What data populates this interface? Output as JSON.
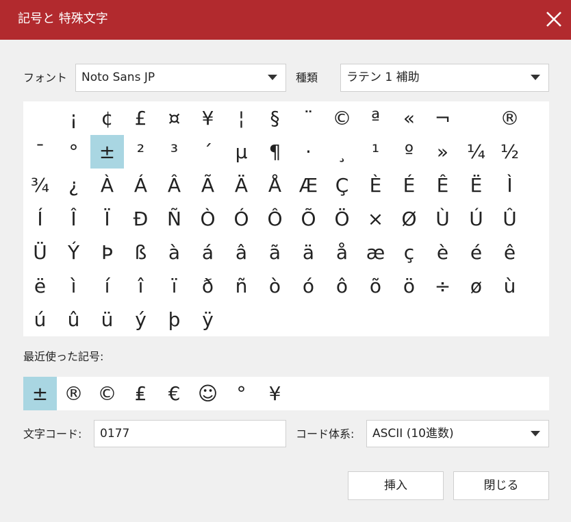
{
  "title": "記号と 特殊文字",
  "font": {
    "label": "フォント",
    "value": "Noto Sans JP"
  },
  "category": {
    "label": "種類",
    "value": "ラテン 1 補助"
  },
  "symbols": [
    "",
    "¡",
    "¢",
    "£",
    "¤",
    "¥",
    "¦",
    "§",
    "¨",
    "©",
    "ª",
    "«",
    "¬",
    "",
    "®",
    "¯",
    "°",
    "±",
    "²",
    "³",
    "´",
    "µ",
    "¶",
    "·",
    "¸",
    "¹",
    "º",
    "»",
    "¼",
    "½",
    "¾",
    "¿",
    "À",
    "Á",
    "Â",
    "Ã",
    "Ä",
    "Å",
    "Æ",
    "Ç",
    "È",
    "É",
    "Ê",
    "Ë",
    "Ì",
    "Í",
    "Î",
    "Ï",
    "Ð",
    "Ñ",
    "Ò",
    "Ó",
    "Ô",
    "Õ",
    "Ö",
    "×",
    "Ø",
    "Ù",
    "Ú",
    "Û",
    "Ü",
    "Ý",
    "Þ",
    "ß",
    "à",
    "á",
    "â",
    "ã",
    "ä",
    "å",
    "æ",
    "ç",
    "è",
    "é",
    "ê",
    "ë",
    "ì",
    "í",
    "î",
    "ï",
    "ð",
    "ñ",
    "ò",
    "ó",
    "ô",
    "õ",
    "ö",
    "÷",
    "ø",
    "ù",
    "ú",
    "û",
    "ü",
    "ý",
    "þ",
    "ÿ"
  ],
  "selected_symbol": "±",
  "recent_label": "最近使った記号:",
  "recent_symbols": [
    "±",
    "®",
    "©",
    "₤",
    "€",
    "☺",
    "°",
    "¥"
  ],
  "char_code": {
    "label": "文字コード:",
    "value": "0177"
  },
  "code_system": {
    "label": "コード体系:",
    "value": "ASCII (10進数)"
  },
  "buttons": {
    "insert": "挿入",
    "close": "閉じる"
  },
  "colors": {
    "titlebar": "#b22a2e",
    "selection": "#a9d6e2"
  }
}
